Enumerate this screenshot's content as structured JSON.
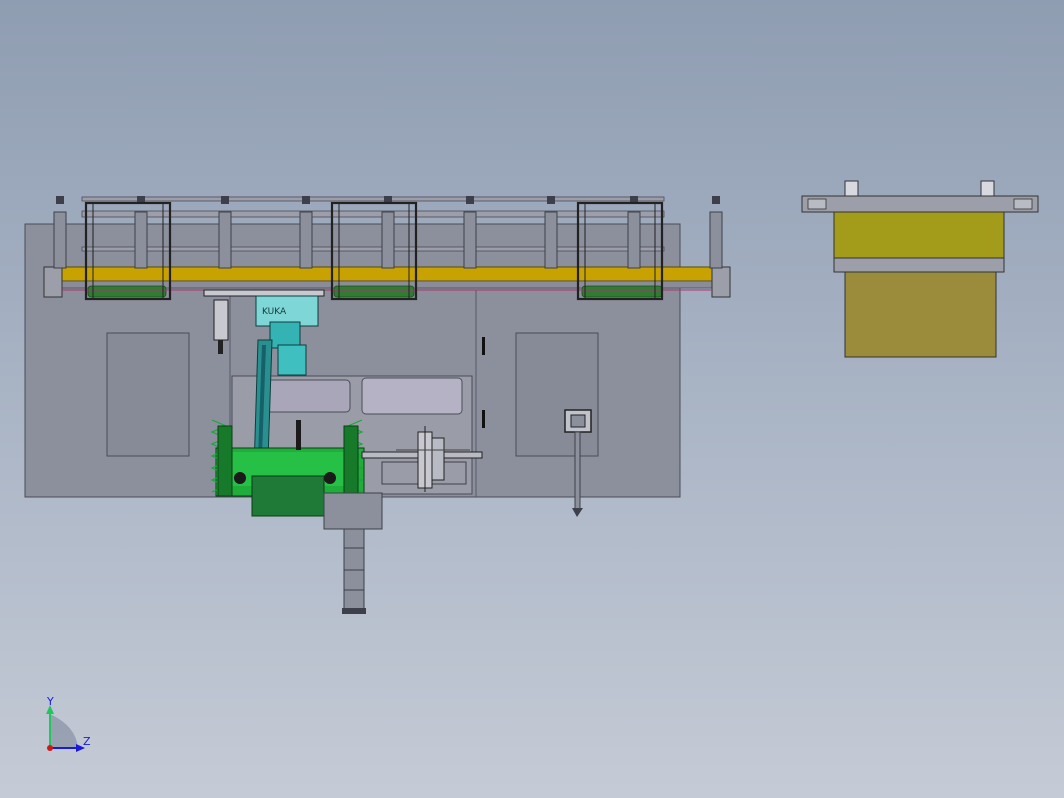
{
  "viewport": {
    "background_top": "#8f9db2",
    "background_bottom": "#c5cbd6"
  },
  "scene": {
    "machine_label": "KUKA"
  },
  "triad": {
    "y_label": "Y",
    "z_label": "Z",
    "y_color": "#22c55e",
    "z_color": "#1a1ad8",
    "origin_color": "#d01818"
  },
  "colors": {
    "frame_gray": "#8c8f9c",
    "frame_edge": "#4a4d58",
    "rail_gold": "#c8a200",
    "rail_green": "#2e7d32",
    "robot_cyan": "#33b3b3",
    "fixture_green": "#1fae3a",
    "olive": "#a39b1a",
    "olive_dark": "#9a8c3a"
  }
}
